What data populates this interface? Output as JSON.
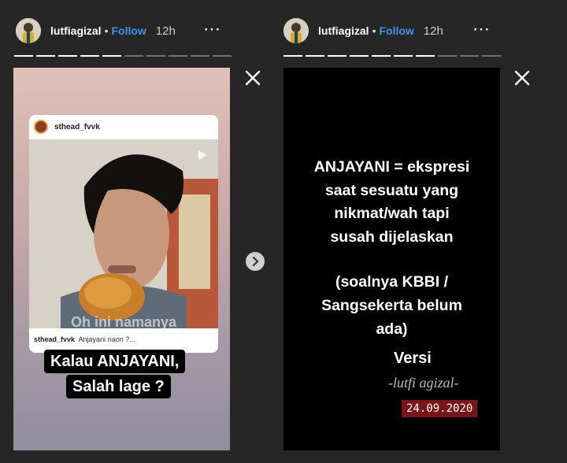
{
  "left": {
    "username": "lutfiagizal",
    "separator": "•",
    "follow_label": "Follow",
    "time": "12h",
    "more_icon": "⋯",
    "shared_post": {
      "username": "sthead_fvvk",
      "caption_user": "sthead_fvvk",
      "caption_text": "Anjayani naon ?...",
      "overlay_text": "Oh ini namanya"
    },
    "caption_lines": [
      "Kalau ANJAYANI,",
      "Salah lage ?"
    ]
  },
  "right": {
    "username": "lutfiagizal",
    "separator": "•",
    "follow_label": "Follow",
    "time": "12h",
    "more_icon": "⋯",
    "definition_lines": [
      "ANJAYANI = ekspresi",
      "saat sesuatu yang",
      "nikmat/wah tapi",
      "susah dijelaskan"
    ],
    "note_lines": [
      "(soalnya KBBI /",
      "Sangsekerta belum",
      "ada)"
    ],
    "versi_label": "Versi",
    "signature": "-lutfi agizal-",
    "date": "24.09.2020"
  },
  "colors": {
    "follow": "#3897f0",
    "background": "#262626",
    "date_badge": "#7a1517"
  }
}
